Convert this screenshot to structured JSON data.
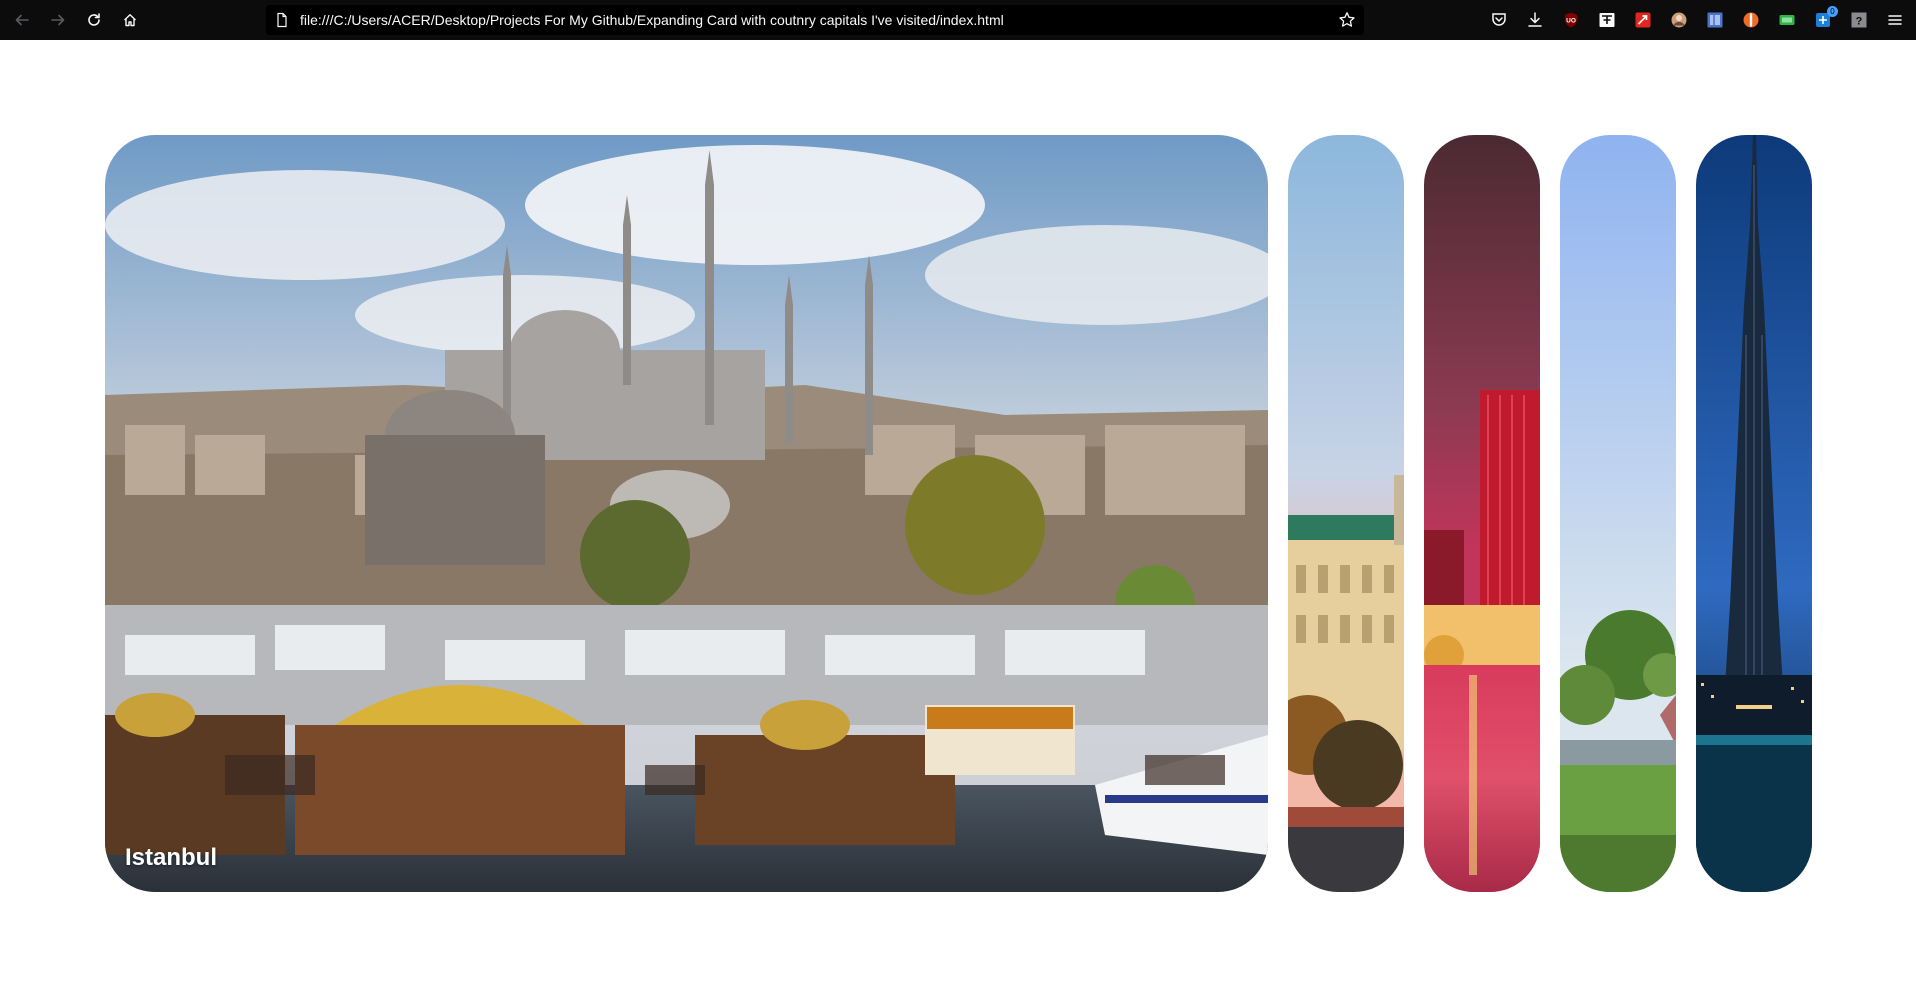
{
  "browser": {
    "url": "file:///C:/Users/ACER/Desktop/Projects For My Github/Expanding Card with coutnry capitals I've visited/index.html",
    "extensions": [
      {
        "name": "pocket-icon"
      },
      {
        "name": "downloads-icon"
      },
      {
        "name": "ublock-icon"
      },
      {
        "name": "translate-icon"
      },
      {
        "name": "red-extension-icon"
      },
      {
        "name": "avatar-extension-icon"
      },
      {
        "name": "blue-extension-icon"
      },
      {
        "name": "orange-extension-icon"
      },
      {
        "name": "green-extension-icon"
      },
      {
        "name": "blue-badge-extension-icon",
        "badge": "0"
      },
      {
        "name": "help-icon"
      },
      {
        "name": "menu-icon"
      }
    ]
  },
  "panels": [
    {
      "title": "Istanbul",
      "active": true,
      "sky_top": "#6f9ac6",
      "sky_bottom": "#d9dde3",
      "ground": "#5a4a3a"
    },
    {
      "title": "",
      "active": false,
      "sky_top": "#8cb7dc",
      "sky_bottom": "#f2b9a9",
      "ground": "#c9a66b"
    },
    {
      "title": "",
      "active": false,
      "sky_top": "#4b2a32",
      "sky_bottom": "#c2355a",
      "ground": "#d93b5c"
    },
    {
      "title": "",
      "active": false,
      "sky_top": "#8fb3f0",
      "sky_bottom": "#dbe6ee",
      "ground": "#5e9a3a"
    },
    {
      "title": "",
      "active": false,
      "sky_top": "#0d3a7a",
      "sky_bottom": "#2f6ac0",
      "ground": "#0b2540"
    }
  ]
}
